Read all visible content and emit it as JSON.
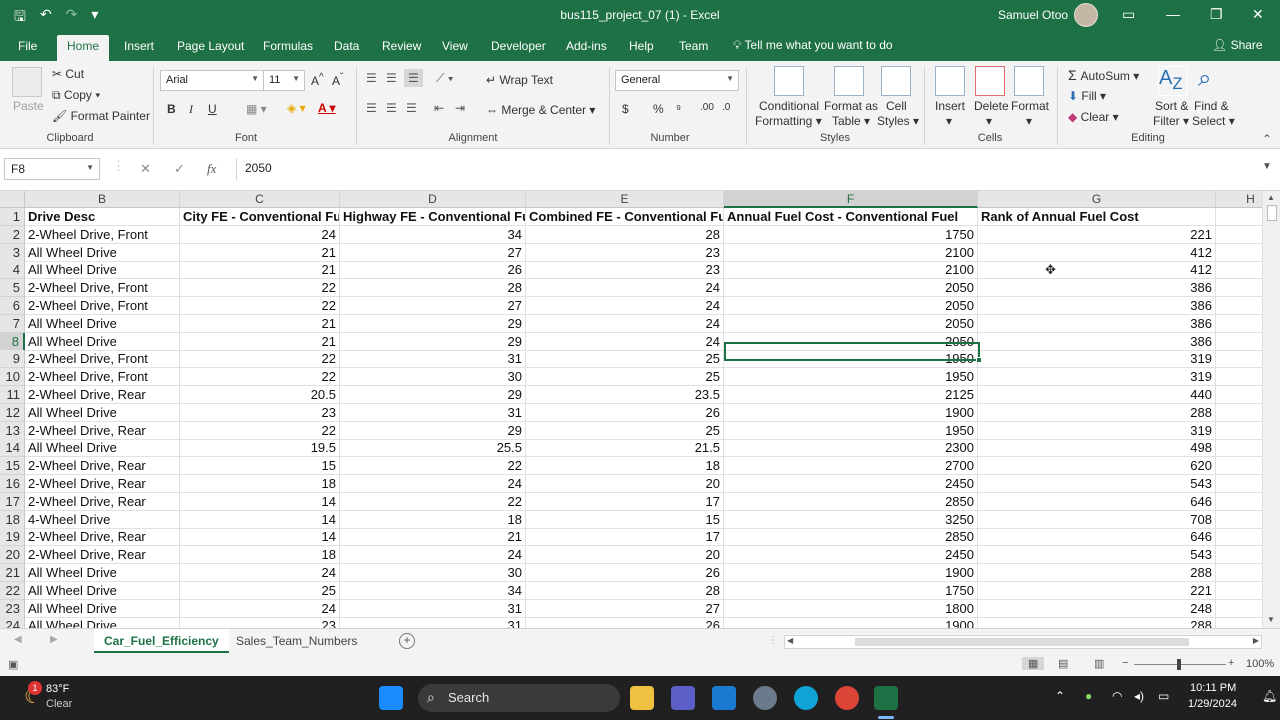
{
  "title_bar": {
    "doc_title": "bus115_project_07 (1)  -  Excel",
    "user_name": "Samuel Otoo",
    "qat": {
      "save": "🖫",
      "undo": "↶",
      "redo": "↷",
      "customize": "▾"
    },
    "window_controls": {
      "ribbon_display": "▭",
      "minimize": "—",
      "restore": "❐",
      "close": "✕"
    }
  },
  "ribbon_tabs": [
    "File",
    "Home",
    "Insert",
    "Page Layout",
    "Formulas",
    "Data",
    "Review",
    "View",
    "Developer",
    "Add-ins",
    "Help",
    "Team"
  ],
  "active_tab": "Home",
  "tell_me": "Tell me what you want to do",
  "share": "Share",
  "clipboard": {
    "paste": "Paste",
    "cut": "Cut",
    "copy": "Copy",
    "format_painter": "Format Painter",
    "label": "Clipboard"
  },
  "font": {
    "name": "Arial",
    "size": "11",
    "bold": "B",
    "italic": "I",
    "underline": "U",
    "label": "Font"
  },
  "alignment": {
    "wrap_text": "Wrap Text",
    "merge_center": "Merge & Center",
    "label": "Alignment"
  },
  "number": {
    "format": "General",
    "currency": "$",
    "percent": "%",
    "comma": "⁹",
    "label": "Number"
  },
  "styles": {
    "conditional_1": "Conditional",
    "conditional_2": "Formatting",
    "format_table_1": "Format as",
    "format_table_2": "Table",
    "cell_styles_1": "Cell",
    "cell_styles_2": "Styles",
    "label": "Styles"
  },
  "cells": {
    "insert": "Insert",
    "delete": "Delete",
    "format": "Format",
    "label": "Cells"
  },
  "editing": {
    "autosum": "AutoSum",
    "fill": "Fill",
    "clear": "Clear",
    "sort_1": "Sort &",
    "sort_2": "Filter",
    "find_1": "Find &",
    "find_2": "Select",
    "label": "Editing"
  },
  "formula_bar": {
    "name_box": "F8",
    "cancel": "✕",
    "enter": "✓",
    "fx": "fx",
    "value": "2050"
  },
  "columns": [
    "B",
    "C",
    "D",
    "E",
    "F",
    "G",
    "H"
  ],
  "selected_column": "F",
  "selected_row": "8",
  "header_row": {
    "row": "1",
    "cells": [
      "Drive Desc",
      "City FE - Conventional Fuel",
      "Highway FE - Conventional Fuel",
      "Combined FE - Conventional Fuel",
      "Annual Fuel Cost - Conventional Fuel",
      "Rank of Annual Fuel Cost",
      ""
    ]
  },
  "rows": [
    {
      "row": "2",
      "cells": [
        "2-Wheel Drive, Front",
        "24",
        "34",
        "28",
        "1750",
        "221",
        ""
      ]
    },
    {
      "row": "3",
      "cells": [
        "All Wheel Drive",
        "21",
        "27",
        "23",
        "2100",
        "412",
        ""
      ]
    },
    {
      "row": "4",
      "cells": [
        "All Wheel Drive",
        "21",
        "26",
        "23",
        "2100",
        "412",
        ""
      ]
    },
    {
      "row": "5",
      "cells": [
        "2-Wheel Drive, Front",
        "22",
        "28",
        "24",
        "2050",
        "386",
        ""
      ]
    },
    {
      "row": "6",
      "cells": [
        "2-Wheel Drive, Front",
        "22",
        "27",
        "24",
        "2050",
        "386",
        ""
      ]
    },
    {
      "row": "7",
      "cells": [
        "All Wheel Drive",
        "21",
        "29",
        "24",
        "2050",
        "386",
        ""
      ]
    },
    {
      "row": "8",
      "cells": [
        "All Wheel Drive",
        "21",
        "29",
        "24",
        "2050",
        "386",
        ""
      ]
    },
    {
      "row": "9",
      "cells": [
        "2-Wheel Drive, Front",
        "22",
        "31",
        "25",
        "1950",
        "319",
        ""
      ]
    },
    {
      "row": "10",
      "cells": [
        "2-Wheel Drive, Front",
        "22",
        "30",
        "25",
        "1950",
        "319",
        ""
      ]
    },
    {
      "row": "11",
      "cells": [
        "2-Wheel Drive, Rear",
        "20.5",
        "29",
        "23.5",
        "2125",
        "440",
        ""
      ]
    },
    {
      "row": "12",
      "cells": [
        "All Wheel Drive",
        "23",
        "31",
        "26",
        "1900",
        "288",
        ""
      ]
    },
    {
      "row": "13",
      "cells": [
        "2-Wheel Drive, Rear",
        "22",
        "29",
        "25",
        "1950",
        "319",
        ""
      ]
    },
    {
      "row": "14",
      "cells": [
        "All Wheel Drive",
        "19.5",
        "25.5",
        "21.5",
        "2300",
        "498",
        ""
      ]
    },
    {
      "row": "15",
      "cells": [
        "2-Wheel Drive, Rear",
        "15",
        "22",
        "18",
        "2700",
        "620",
        ""
      ]
    },
    {
      "row": "16",
      "cells": [
        "2-Wheel Drive, Rear",
        "18",
        "24",
        "20",
        "2450",
        "543",
        ""
      ]
    },
    {
      "row": "17",
      "cells": [
        "2-Wheel Drive, Rear",
        "14",
        "22",
        "17",
        "2850",
        "646",
        ""
      ]
    },
    {
      "row": "18",
      "cells": [
        "4-Wheel Drive",
        "14",
        "18",
        "15",
        "3250",
        "708",
        ""
      ]
    },
    {
      "row": "19",
      "cells": [
        "2-Wheel Drive, Rear",
        "14",
        "21",
        "17",
        "2850",
        "646",
        ""
      ]
    },
    {
      "row": "20",
      "cells": [
        "2-Wheel Drive, Rear",
        "18",
        "24",
        "20",
        "2450",
        "543",
        ""
      ]
    },
    {
      "row": "21",
      "cells": [
        "All Wheel Drive",
        "24",
        "30",
        "26",
        "1900",
        "288",
        ""
      ]
    },
    {
      "row": "22",
      "cells": [
        "All Wheel Drive",
        "25",
        "34",
        "28",
        "1750",
        "221",
        ""
      ]
    },
    {
      "row": "23",
      "cells": [
        "All Wheel Drive",
        "24",
        "31",
        "27",
        "1800",
        "248",
        ""
      ]
    },
    {
      "row": "24",
      "cells": [
        "All Wheel Drive",
        "23",
        "31",
        "26",
        "1900",
        "288",
        ""
      ]
    }
  ],
  "sheet_tabs": [
    "Car_Fuel_Efficiency",
    "Sales_Team_Numbers"
  ],
  "active_sheet": "Car_Fuel_Efficiency",
  "add_sheet": "+",
  "status": {
    "zoom": "100%"
  },
  "taskbar": {
    "weather_temp": "83°F",
    "weather_desc": "Clear",
    "weather_badge": "1",
    "search": "Search",
    "time": "10:11 PM",
    "date": "1/29/2024"
  },
  "colors": {
    "excel_green": "#1e7145",
    "taskbar": "#202020",
    "ribbon": "#f3f3f3"
  }
}
